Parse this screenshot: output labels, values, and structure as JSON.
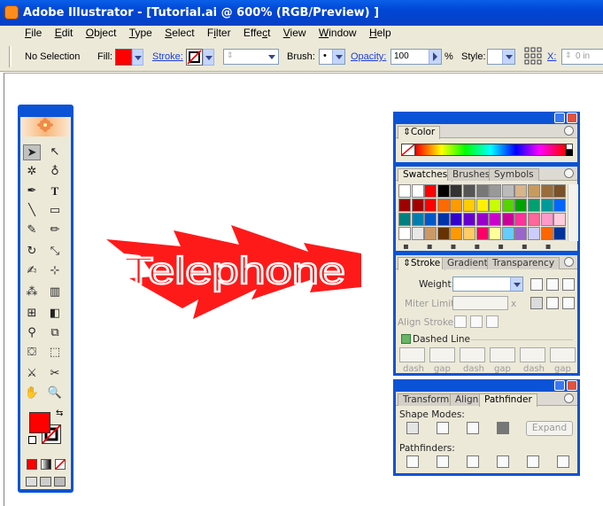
{
  "window": {
    "title": "Adobe Illustrator - [Tutorial.ai @ 600% (RGB/Preview) ]"
  },
  "menu": {
    "items": [
      {
        "label": "File",
        "key": "F",
        "rest": "ile"
      },
      {
        "label": "Edit",
        "key": "E",
        "rest": "dit"
      },
      {
        "label": "Object",
        "key": "O",
        "rest": "bject"
      },
      {
        "label": "Type",
        "key": "T",
        "rest": "ype"
      },
      {
        "label": "Select",
        "key": "S",
        "rest": "elect"
      },
      {
        "label": "Filter",
        "key": "i",
        "pre": "F",
        "rest": "lter"
      },
      {
        "label": "Effect",
        "key": "c",
        "pre": "Effe",
        "rest": "t"
      },
      {
        "label": "View",
        "key": "V",
        "rest": "iew"
      },
      {
        "label": "Window",
        "key": "W",
        "rest": "indow"
      },
      {
        "label": "Help",
        "key": "H",
        "rest": "elp"
      }
    ]
  },
  "control": {
    "selection": "No Selection",
    "fill_label": "Fill:",
    "stroke_label": "Stroke:",
    "brush_label": "Brush:",
    "brush_value": "•",
    "opacity_label": "Opacity:",
    "opacity_value": "100",
    "percent": "%",
    "style_label": "Style:",
    "x_label": "X:",
    "x_value": "0 in",
    "fill_color": "#ff0000"
  },
  "artwork": {
    "text": "Telephone",
    "color": "#ff1a1a"
  },
  "color_panel": {
    "tab": "Color"
  },
  "swatches_panel": {
    "tabs": [
      "Swatches",
      "Brushes",
      "Symbols"
    ]
  },
  "stroke_panel": {
    "tabs": [
      "Stroke",
      "Gradient",
      "Transparency"
    ],
    "weight_label": "Weight:",
    "miter_label": "Miter Limit:",
    "miter_unit": "x",
    "align_label": "Align Stroke:",
    "dashed_label": "Dashed Line",
    "dash_labels": [
      "dash",
      "gap",
      "dash",
      "gap",
      "dash",
      "gap"
    ]
  },
  "pathfinder_panel": {
    "tabs": [
      "Transform",
      "Align",
      "Pathfinder"
    ],
    "shape_modes_label": "Shape Modes:",
    "expand_label": "Expand",
    "pathfinders_label": "Pathfinders:"
  },
  "colors": {
    "titlebar": "#0046d5",
    "chrome": "#ece9d8",
    "accent": "#0a53d6",
    "fill": "#ff0000"
  },
  "swatch_rows": [
    [
      "#ffffff",
      "#ffffff",
      "#ff0000",
      "#000000",
      "#333333",
      "#555555",
      "#777777",
      "#999999",
      "#bbbbbb",
      "#d8b48c",
      "#c79b5e",
      "#9a6d3b",
      "#7a5128"
    ],
    [
      "#9e0000",
      "#a50000",
      "#ff0000",
      "#ff6a00",
      "#ff9a00",
      "#ffcc00",
      "#fff000",
      "#c8ff00",
      "#55d400",
      "#00a400",
      "#00a070",
      "#009a9a",
      "#0066ff"
    ],
    [
      "#00807f",
      "#007fae",
      "#0057c8",
      "#0033a8",
      "#3300cc",
      "#6600cc",
      "#9900cc",
      "#cc00cc",
      "#cc0099",
      "#ff3399",
      "#ff6699",
      "#ff99cc",
      "#ffccdd"
    ],
    [
      "#ffffff",
      "#e8e8e8",
      "#cc9966",
      "#663300",
      "#ff9900",
      "#ffcc66",
      "#ff0066",
      "#ffff99",
      "#66ccff",
      "#9966cc",
      "#ccccff",
      "#ff6600",
      "#003399"
    ]
  ]
}
